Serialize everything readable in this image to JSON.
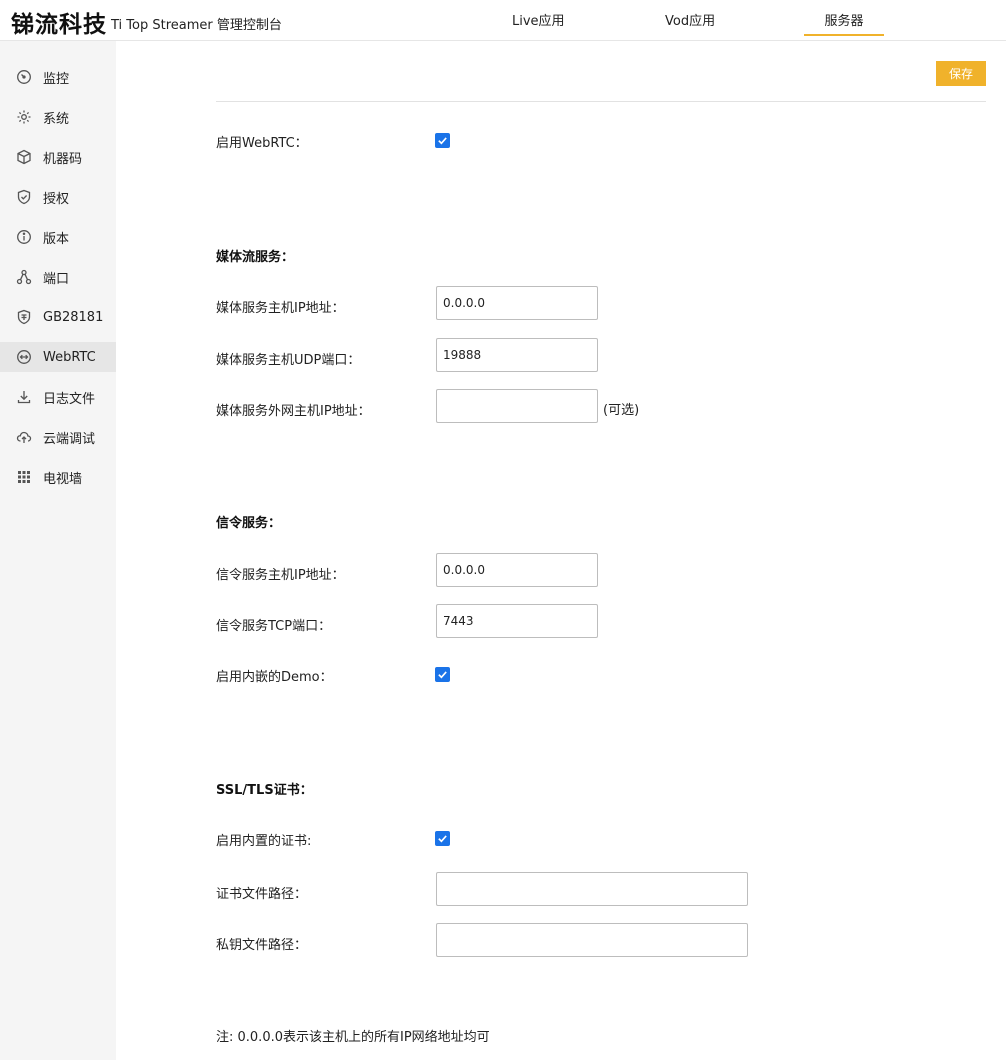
{
  "header": {
    "brand": "锑流科技",
    "subtitle": "Ti Top Streamer 管理控制台",
    "nav": [
      {
        "label": "Live应用"
      },
      {
        "label": "Vod应用"
      },
      {
        "label": "服务器",
        "active": true
      }
    ],
    "accent_color": "#f0b22b"
  },
  "sidebar": {
    "items": [
      {
        "label": "监控",
        "icon": "gauge-icon"
      },
      {
        "label": "系统",
        "icon": "gear-icon"
      },
      {
        "label": "机器码",
        "icon": "cube-icon"
      },
      {
        "label": "授权",
        "icon": "shield-check-icon"
      },
      {
        "label": "版本",
        "icon": "info-icon"
      },
      {
        "label": "端口",
        "icon": "network-icon"
      },
      {
        "label": "GB28181",
        "icon": "badge-icon"
      },
      {
        "label": "WebRTC",
        "icon": "arrows-circle-icon",
        "active": true
      },
      {
        "label": "日志文件",
        "icon": "download-icon"
      },
      {
        "label": "云端调试",
        "icon": "cloud-upload-icon"
      },
      {
        "label": "电视墙",
        "icon": "grid-icon"
      }
    ]
  },
  "toolbar": {
    "save_label": "保存"
  },
  "form": {
    "enable_webrtc": {
      "label": "启用WebRTC：",
      "checked": true
    },
    "media": {
      "title": "媒体流服务：",
      "host_ip": {
        "label": "媒体服务主机IP地址：",
        "value": "0.0.0.0"
      },
      "udp_port": {
        "label": "媒体服务主机UDP端口：",
        "value": "19888"
      },
      "external_ip": {
        "label": "媒体服务外网主机IP地址：",
        "value": "",
        "optional": "(可选)"
      }
    },
    "signal": {
      "title": "信令服务：",
      "host_ip": {
        "label": "信令服务主机IP地址：",
        "value": "0.0.0.0"
      },
      "tcp_port": {
        "label": "信令服务TCP端口：",
        "value": "7443"
      },
      "demo": {
        "label": "启用内嵌的Demo：",
        "checked": true
      }
    },
    "ssl": {
      "title": "SSL/TLS证书：",
      "builtin": {
        "label": "启用内置的证书:",
        "checked": true
      },
      "cert_path": {
        "label": "证书文件路径：",
        "value": ""
      },
      "key_path": {
        "label": "私钥文件路径：",
        "value": ""
      }
    },
    "note": "注: 0.0.0.0表示该主机上的所有IP网络地址均可"
  }
}
